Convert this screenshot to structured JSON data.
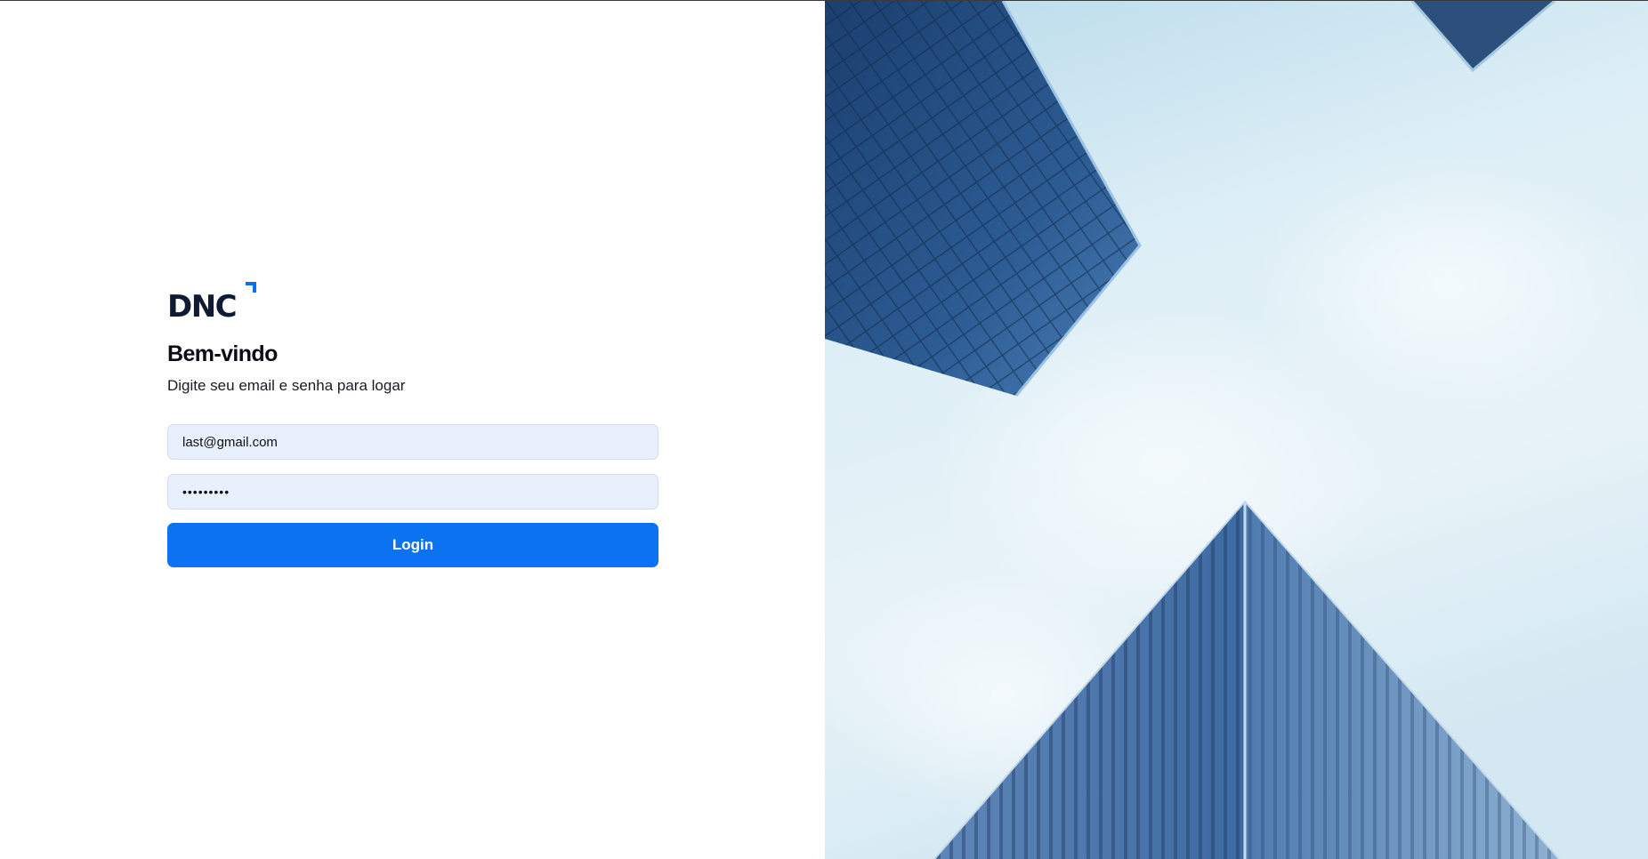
{
  "logo": {
    "text": "DNC",
    "accent_color": "#0b6ff2",
    "text_color": "#0f1a33"
  },
  "login": {
    "title": "Bem-vindo",
    "subtitle": "Digite seu email e senha para logar",
    "email_value": "last@gmail.com",
    "password_value": "•••••••••",
    "button_label": "Login"
  },
  "hero": {
    "icon": "skyscrapers-photo"
  },
  "colors": {
    "button": "#0b72f1",
    "input_bg": "#e8effd",
    "sky_light": "#e3f1f8",
    "building_blue": "#27528c"
  }
}
